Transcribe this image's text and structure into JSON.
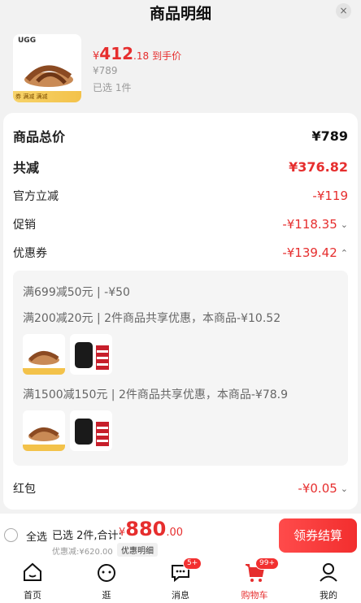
{
  "header": {
    "title": "商品明细",
    "close": "×"
  },
  "product": {
    "brand": "UGG",
    "strip_text": "券 满减 满减",
    "price_yen": "¥",
    "price_int": "412",
    "price_dec": ".18",
    "price_tag": "到手价",
    "original_price": "¥789",
    "selected_count": "已选 1件"
  },
  "breakdown": {
    "total_label": "商品总价",
    "total_value": "¥789",
    "reduce_label": "共减",
    "reduce_value": "¥376.82",
    "official_label": "官方立减",
    "official_value": "-¥119",
    "promo_label": "促销",
    "promo_value": "-¥118.35",
    "coupon_label": "优惠券",
    "coupon_value": "-¥139.42",
    "redpacket_label": "红包",
    "redpacket_value": "-¥0.05"
  },
  "coupons": {
    "line1": "满699减50元 | -¥50",
    "line2": "满200减20元 | 2件商品共享优惠，本商品-¥10.52",
    "line3": "满1500减150元 | 2件商品共享优惠，本商品-¥78.9"
  },
  "bottom": {
    "select_all": "全选",
    "summary": "已选 2件,合计:",
    "total_yen": "¥",
    "total_int": "880",
    "total_dec": ".00",
    "saved": "优惠减:¥620.00",
    "detail": "优惠明细",
    "checkout": "领券结算"
  },
  "tabs": [
    {
      "label": "首页",
      "icon": "home-icon"
    },
    {
      "label": "逛",
      "icon": "browse-icon"
    },
    {
      "label": "消息",
      "icon": "message-icon",
      "badge": "5+"
    },
    {
      "label": "购物车",
      "icon": "cart-icon",
      "badge": "99+"
    },
    {
      "label": "我的",
      "icon": "profile-icon"
    }
  ],
  "colors": {
    "accent": "#e62e2e",
    "background": "#f2f2f2"
  }
}
